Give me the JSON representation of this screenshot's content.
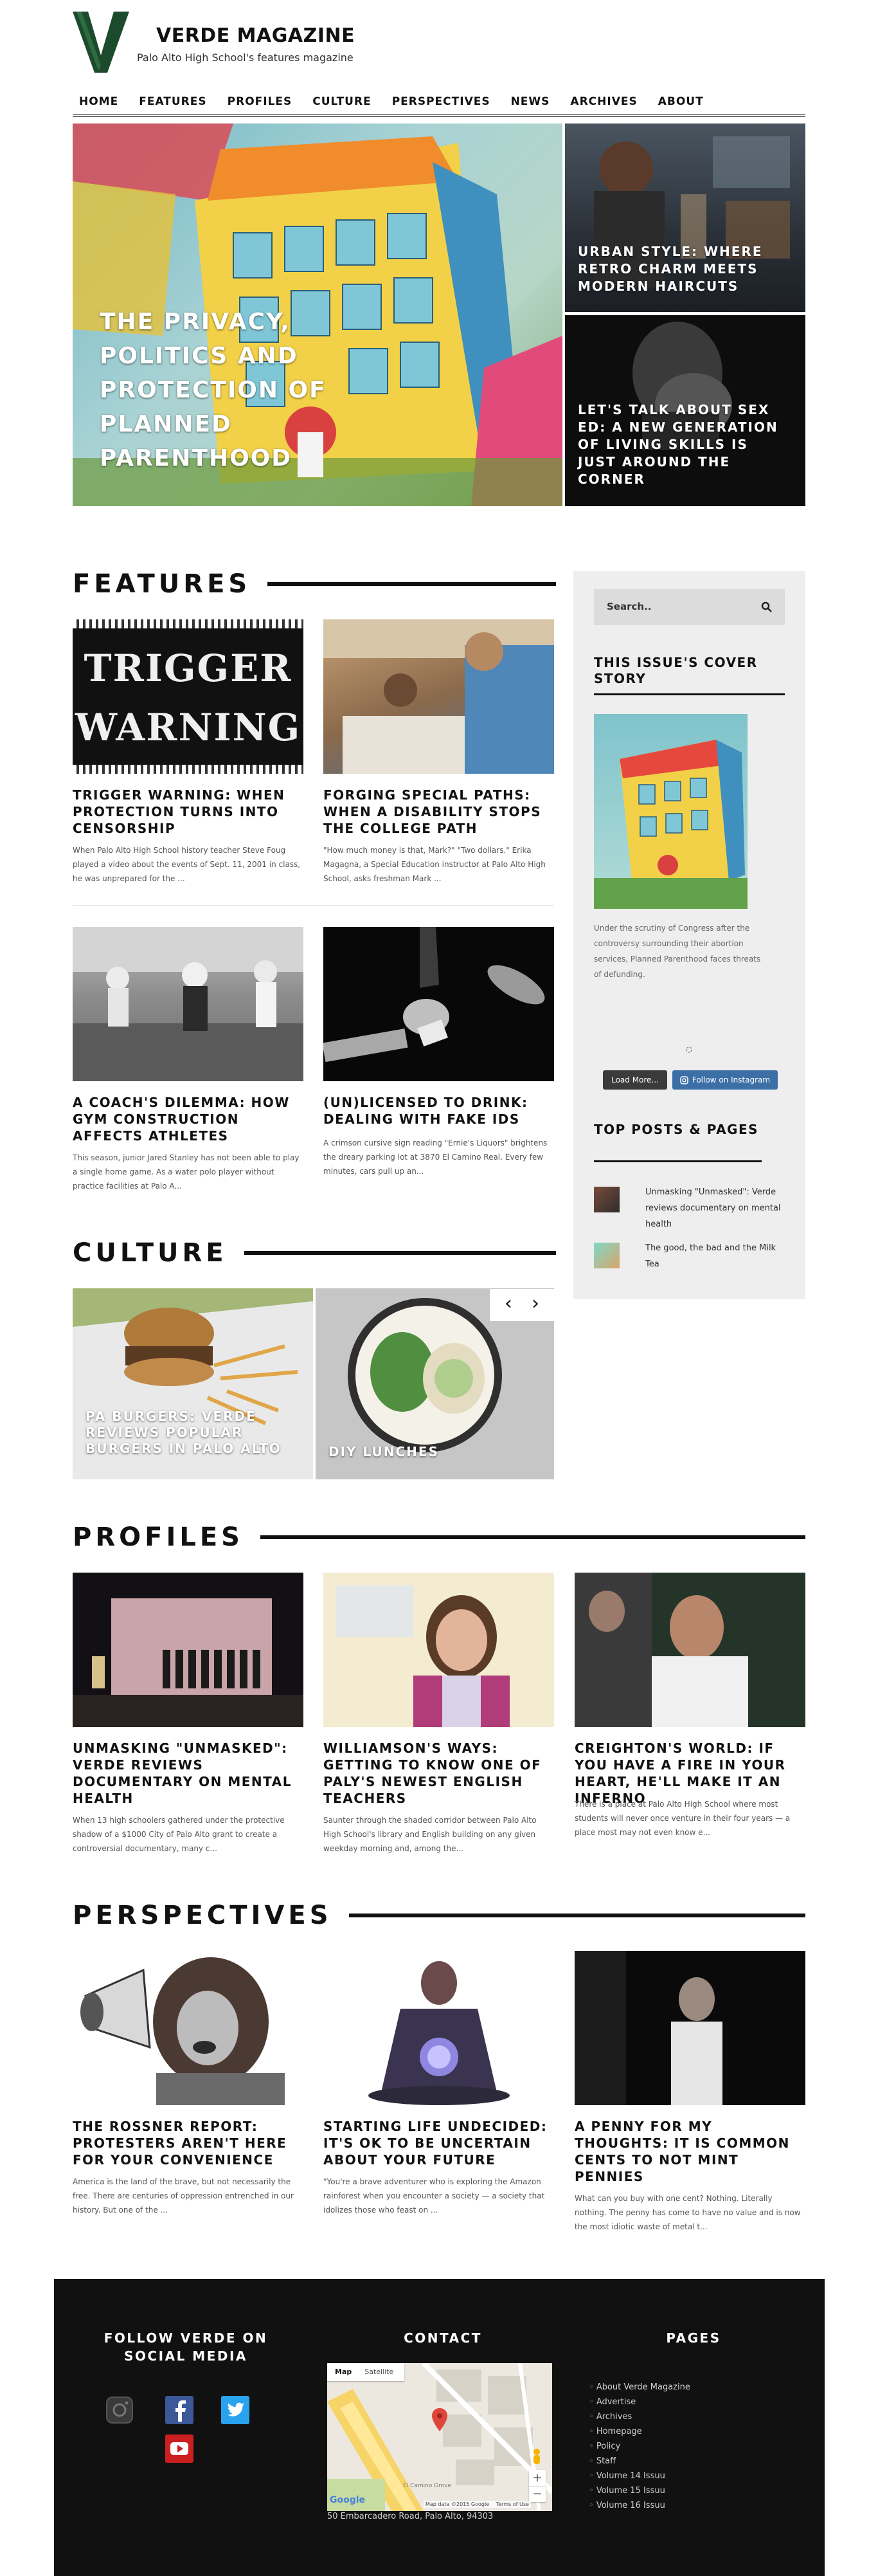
{
  "brand": {
    "title": "VERDE MAGAZINE",
    "tagline": "Palo Alto High School's features magazine",
    "colors": {
      "green": "#1c4a2c",
      "black": "#111111",
      "sidebar_bg": "#eeeeee",
      "instagram_blue": "#3d6fa7"
    }
  },
  "nav": [
    "HOME",
    "FEATURES",
    "PROFILES",
    "CULTURE",
    "PERSPECTIVES",
    "NEWS",
    "ARCHIVES",
    "ABOUT"
  ],
  "hero": {
    "main": "THE PRIVACY, POLITICS AND PROTECTION OF PLANNED PARENTHOOD",
    "side_top": "URBAN STYLE: WHERE RETRO CHARM MEETS MODERN HAIRCUTS",
    "side_bottom": "LET'S TALK ABOUT SEX ED: A NEW GENERATION OF LIVING SKILLS IS JUST AROUND THE CORNER"
  },
  "features": {
    "heading": "FEATURES",
    "items": [
      {
        "title": "TRIGGER WARNING: WHEN PROTECTION TURNS INTO CENSORSHIP",
        "excerpt": "When Palo Alto High School history teacher Steve Foug played a video about the events of Sept. 11, 2001 in class, he was unprepared for the ...",
        "image_text": "TRIGGER WARNING"
      },
      {
        "title": "FORGING SPECIAL PATHS: WHEN A DISABILITY STOPS THE COLLEGE PATH",
        "excerpt": "\"How much money is that, Mark?\" \"Two dollars.\" Erika Magagna, a Special Education instructor at Palo Alto High School, asks freshman Mark ..."
      },
      {
        "title": "A COACH'S DILEMMA: HOW GYM CONSTRUCTION AFFECTS ATHLETES",
        "excerpt": "This season, junior Jared Stanley has not been able to play a single home game. As a water polo player without practice facilities at Palo A..."
      },
      {
        "title": "(UN)LICENSED TO DRINK: DEALING WITH FAKE IDS",
        "excerpt": "A crimson cursive sign reading \"Ernie's Liquors\" brightens the dreary parking lot at 3870 El Camino Real. Every few minutes, cars pull up an..."
      }
    ]
  },
  "culture": {
    "heading": "CULTURE",
    "items": [
      {
        "title": "PA BURGERS: VERDE REVIEWS POPULAR BURGERS IN PALO ALTO"
      },
      {
        "title": "DIY LUNCHES"
      }
    ],
    "prev_icon": "‹",
    "next_icon": "›"
  },
  "profiles": {
    "heading": "PROFILES",
    "items": [
      {
        "title": "UNMASKING \"UNMASKED\": VERDE REVIEWS DOCUMENTARY ON MENTAL HEALTH",
        "excerpt": "When 13 high schoolers gathered under the protective shadow of a $1000 City of Palo Alto grant to create a controversial documentary, many c..."
      },
      {
        "title": "WILLIAMSON'S WAYS: GETTING TO KNOW ONE OF PALY'S NEWEST ENGLISH TEACHERS",
        "excerpt": "Saunter through the shaded corridor between Palo Alto High School's library and English building on any given weekday morning and, among the..."
      },
      {
        "title": "CREIGHTON'S WORLD: IF YOU HAVE A FIRE IN YOUR HEART, HE'LL MAKE IT AN INFERNO",
        "excerpt": "There is a place at Palo Alto High School where most students will never once venture in their four years — a place most may not even know e..."
      }
    ]
  },
  "perspectives": {
    "heading": "PERSPECTIVES",
    "items": [
      {
        "title": "THE ROSSNER REPORT: PROTESTERS AREN'T HERE FOR YOUR CONVENIENCE",
        "excerpt": "America is the land of the brave, but not necessarily the free. There are centuries of oppression entrenched in our history. But one of the ..."
      },
      {
        "title": "STARTING LIFE UNDECIDED: IT'S OK TO BE UNCERTAIN ABOUT YOUR FUTURE",
        "excerpt": "\"You're a brave adventurer who is exploring the Amazon rainforest when you encounter a society — a society that idolizes those who feast on ..."
      },
      {
        "title": "A PENNY FOR MY THOUGHTS: IT IS COMMON CENTS TO NOT MINT PENNIES",
        "excerpt": "What can you buy with one cent? Nothing. Literally nothing. The penny has come to have no value and is now the most idiotic waste of metal t..."
      }
    ]
  },
  "sidebar": {
    "search_placeholder": "Search..",
    "cover_heading": "THIS ISSUE'S COVER STORY",
    "cover_text": "Under the scrutiny of Congress after the controversy surrounding their abortion services, Planned Parenthood faces threats of defunding.",
    "load_more": "Load More...",
    "follow_instagram": "Follow on Instagram",
    "top_posts_heading": "TOP POSTS & PAGES",
    "top_posts": [
      "Unmasking \"Unmasked\": Verde reviews documentary on mental health",
      "The good, the bad and the Milk Tea"
    ]
  },
  "footer": {
    "social_heading": "FOLLOW VERDE ON SOCIAL MEDIA",
    "contact_heading": "CONTACT",
    "pages_heading": "PAGES",
    "address": "50 Embarcadero Road, Palo Alto, 94303",
    "map": {
      "tab_map": "Map",
      "tab_satellite": "Satellite",
      "street_label": "El Camino Grove",
      "copyright": "Map data ©2015 Google",
      "terms": "Terms of Use",
      "google": "Google"
    },
    "pages": [
      "About Verde Magazine",
      "Advertise",
      "Archives",
      "Homepage",
      "Policy",
      "Staff",
      "Volume 14 Issuu",
      "Volume 15 Issuu",
      "Volume 16 Issuu"
    ]
  }
}
